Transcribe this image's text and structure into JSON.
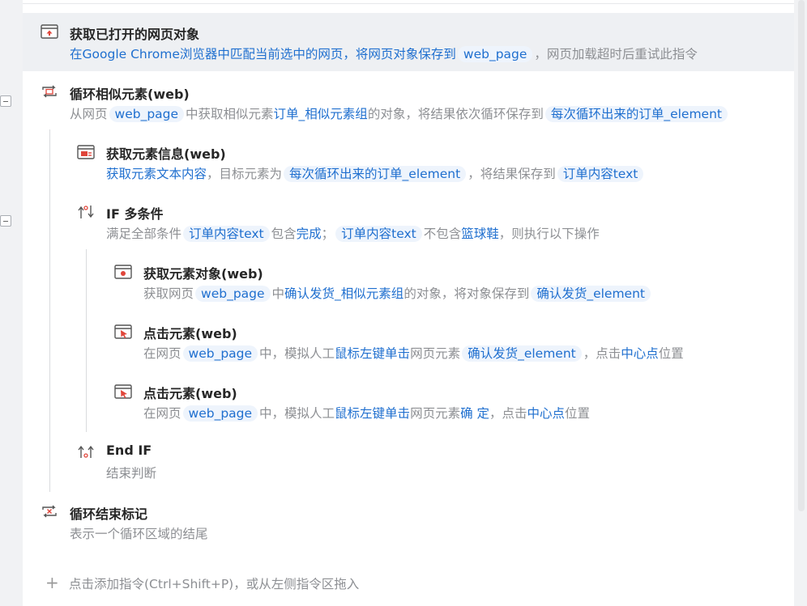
{
  "steps": {
    "s1": {
      "title": "获取已打开的网页对象",
      "d1": "在Google Chrome浏览器中匹配当前选中的网页，将网页对象保存到",
      "v1": "web_page",
      "d2": "，",
      "d3": "网页加载超时后重试此指令"
    },
    "s2": {
      "title": "循环相似元素(web)",
      "d1": "从网页",
      "v1": "web_page",
      "d2": "中获取相似元素",
      "k1": "订单_相似元素组",
      "d3": "的对象，将结果依次循环保存到",
      "v2": "每次循环出来的订单_element"
    },
    "s3": {
      "title": "获取元素信息(web)",
      "k0": "获取元素文本内容",
      "d1": "，目标元素为",
      "v1": "每次循环出来的订单_element",
      "d2": "，",
      "d3": "将结果保存到",
      "v2": "订单内容text"
    },
    "s4": {
      "title": "IF 多条件",
      "d1": "满足全部条件",
      "v1": "订单内容text",
      "d2": "包含",
      "k1": "完成",
      "d3": "；",
      "v2": "订单内容text",
      "d4": "不包含",
      "k2": "篮球鞋",
      "d5": "，则执行以下操作"
    },
    "s5": {
      "title": "获取元素对象(web)",
      "d1": "获取网页",
      "v1": "web_page",
      "d2": "中",
      "k1": "确认发货_相似元素组",
      "d3": "的对象，将对象保存到",
      "v2": "确认发货_element"
    },
    "s6": {
      "title": "点击元素(web)",
      "d1": "在网页",
      "v1": "web_page",
      "d2": "中，模拟人工",
      "k1": "鼠标左键单击",
      "d3": "网页元素",
      "v2": "确认发货_element",
      "d4": "，点击",
      "k2": "中心点",
      "d5": "位置"
    },
    "s7": {
      "title": "点击元素(web)",
      "d1": "在网页",
      "v1": "web_page",
      "d2": "中，模拟人工",
      "k1": "鼠标左键单击",
      "d3": "网页元素",
      "k2": "确 定",
      "d4": "，点击",
      "k3": "中心点",
      "d5": "位置"
    },
    "s8": {
      "title": "End IF",
      "d1": "结束判断"
    },
    "s9": {
      "title": "循环结束标记",
      "d1": "表示一个循环区域的结尾"
    }
  },
  "footer": {
    "add_icon": "+",
    "add_text": "点击添加指令(Ctrl+Shift+P)，或从左侧指令区拖入"
  },
  "colors": {
    "keyword": "#1f6fcf",
    "variable_bg": "#eef4fc",
    "icon_red": "#e0453a",
    "selected_row_bg": "#eef0f3"
  },
  "icons": {
    "s1": "browser-open-icon",
    "s2": "loop-icon",
    "s3": "element-info-icon",
    "s4": "if-icon",
    "s5": "element-object-icon",
    "s6": "click-element-icon",
    "s7": "click-element-icon",
    "s8": "end-if-icon",
    "s9": "loop-end-icon"
  }
}
